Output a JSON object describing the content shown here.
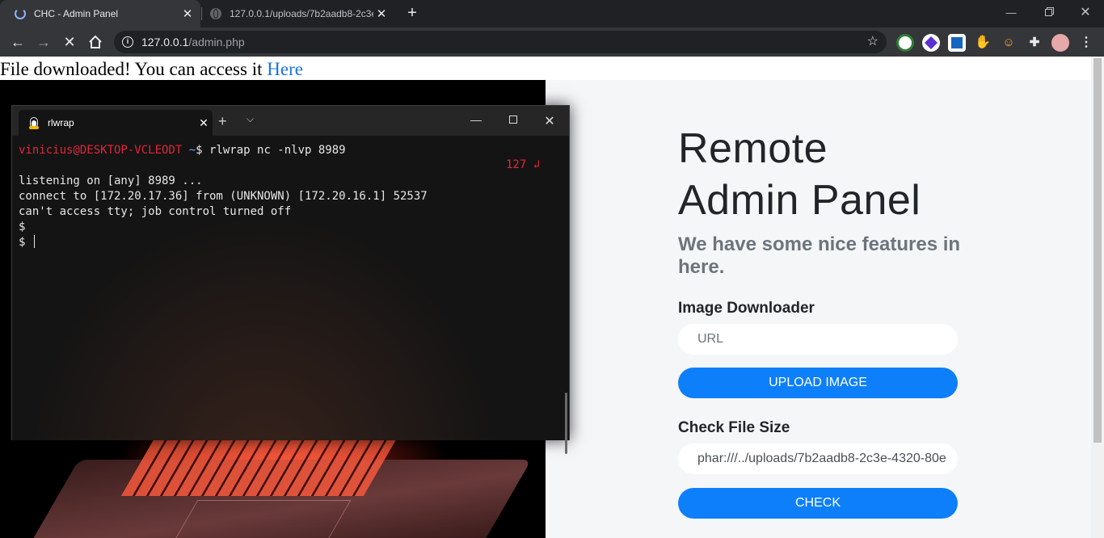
{
  "browser": {
    "tabs": [
      {
        "title": "CHC - Admin Panel",
        "active": true
      },
      {
        "title": "127.0.0.1/uploads/7b2aadb8-2c3e-4320-80e",
        "active": false
      }
    ],
    "address": {
      "host": "127.0.0.1",
      "path": "/admin.php"
    },
    "extensions": [
      "green-circle-extension-icon",
      "purple-diamond-extension-icon",
      "blue-square-extension-icon",
      "red-hand-extension-icon",
      "face-extension-icon",
      "puzzle-icon",
      "profile-avatar"
    ]
  },
  "page": {
    "message": "File downloaded! You can access it ",
    "message_link": "Here",
    "title_line1": "Remote",
    "title_line2": "Admin Panel",
    "subtitle": "We have some nice features in here.",
    "image_downloader_label": "Image Downloader",
    "url_placeholder": "URL",
    "upload_button": "UPLOAD IMAGE",
    "file_size_label": "Check File Size",
    "file_size_value": "phar:///../uploads/7b2aadb8-2c3e-4320-80e",
    "check_button": "CHECK"
  },
  "terminal": {
    "tab_title": "rlwrap",
    "prompt_user": "vinicius@DESKTOP-VCLEODT",
    "prompt_path": " ~",
    "command": "$ rlwrap nc -nlvp 8989",
    "right_status": "127 ↲",
    "lines": [
      "listening on [any] 8989 ...",
      "connect to [172.20.17.36] from (UNKNOWN) [172.20.16.1] 52537",
      "can't access tty; job control turned off",
      "$",
      "$ "
    ]
  },
  "colors": {
    "accent_button": "#0d7ffb",
    "link": "#1a73e8",
    "terminal_prompt_user": "#e0263a",
    "terminal_prompt_path": "#6aa2ff"
  }
}
